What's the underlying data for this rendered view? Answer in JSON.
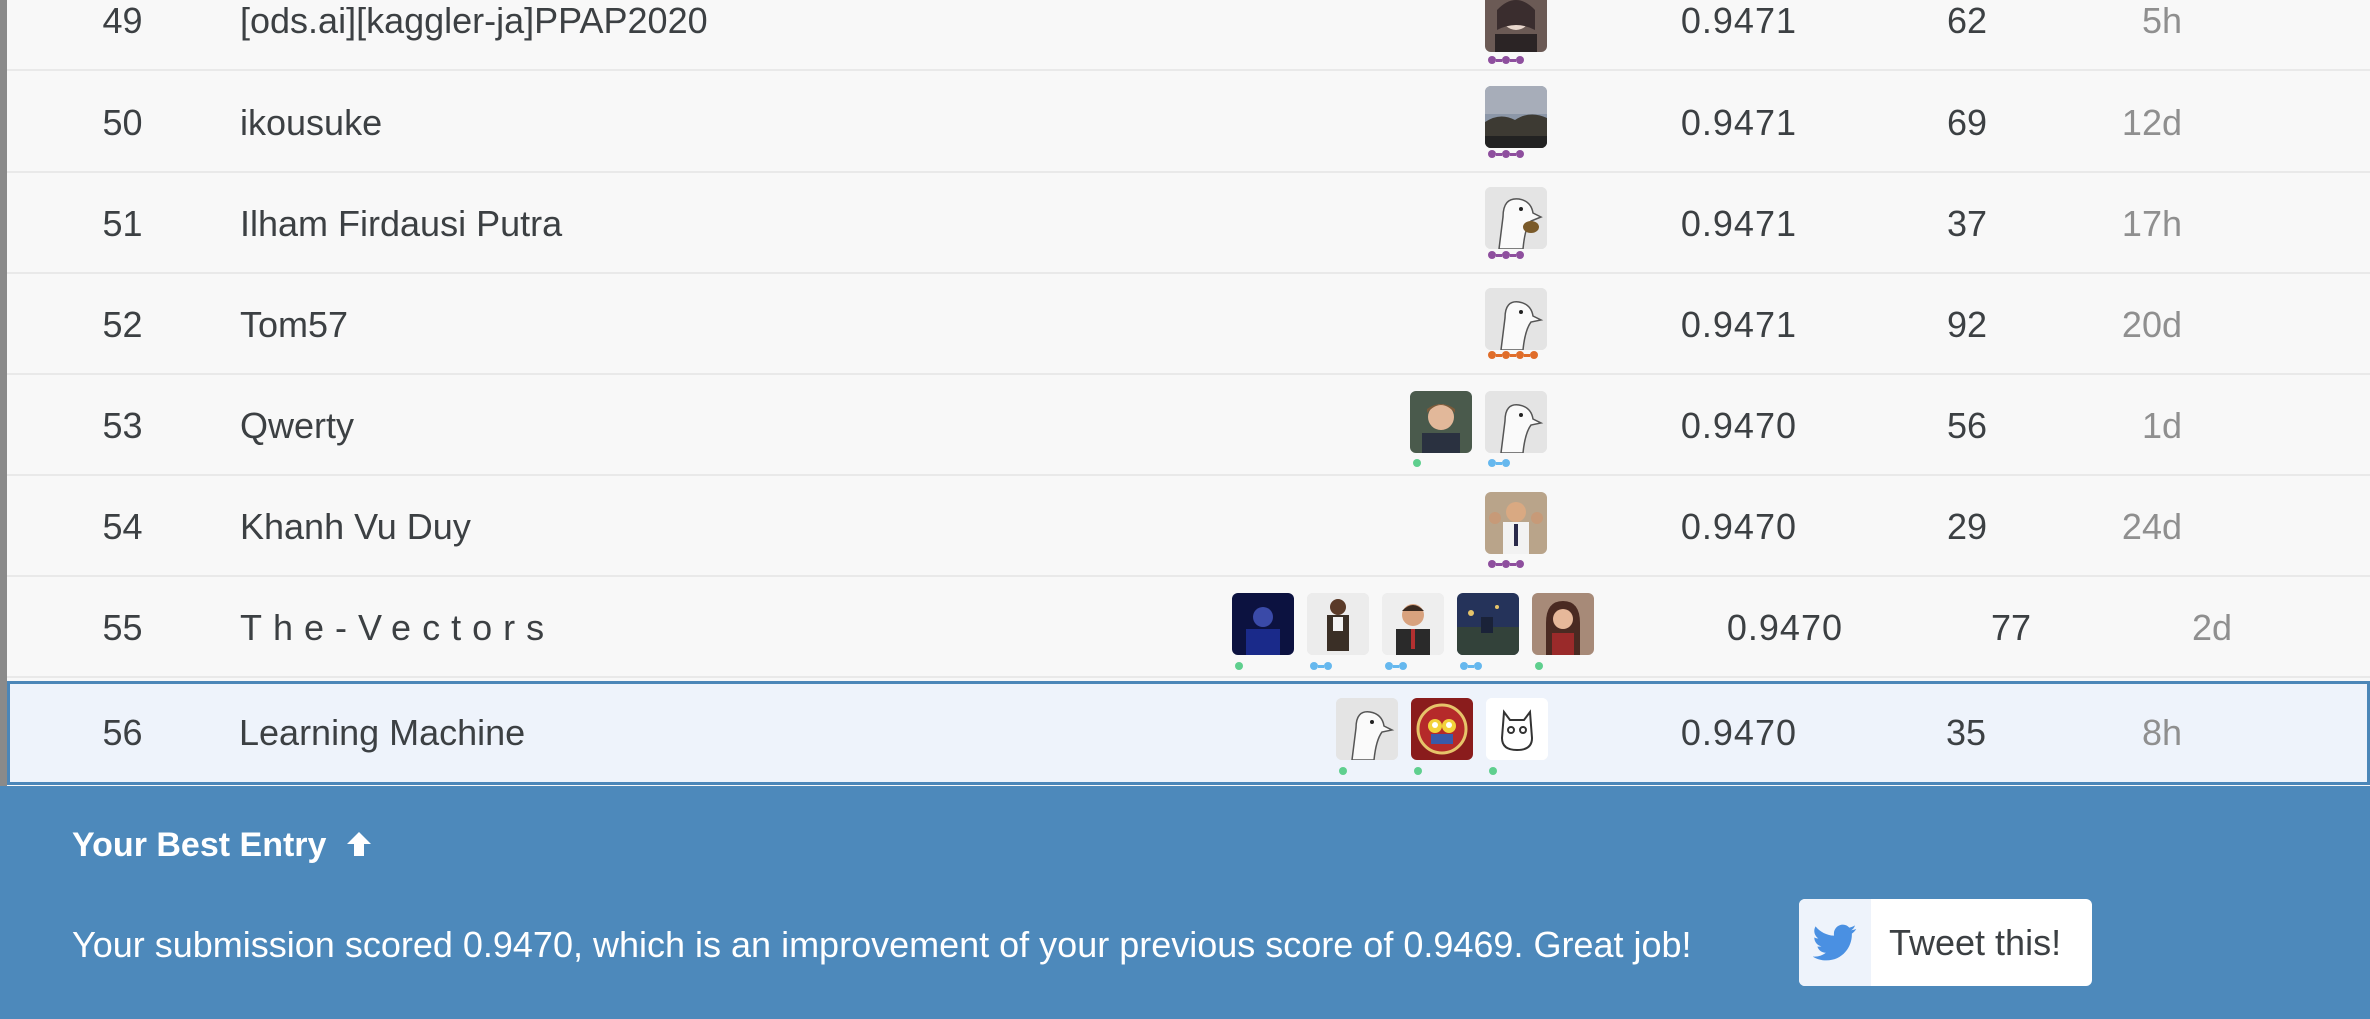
{
  "leaderboard": {
    "rows": [
      {
        "rank": "49",
        "team": "[ods.ai][kaggler-ja]PPAP2020",
        "score": "0.9471",
        "entries": "62",
        "last": "5h"
      },
      {
        "rank": "50",
        "team": "ikousuke",
        "score": "0.9471",
        "entries": "69",
        "last": "12d"
      },
      {
        "rank": "51",
        "team": "Ilham Firdausi Putra",
        "score": "0.9471",
        "entries": "37",
        "last": "17h"
      },
      {
        "rank": "52",
        "team": "Tom57",
        "score": "0.9471",
        "entries": "92",
        "last": "20d"
      },
      {
        "rank": "53",
        "team": "Qwerty",
        "score": "0.9470",
        "entries": "56",
        "last": "1d"
      },
      {
        "rank": "54",
        "team": "Khanh Vu Duy",
        "score": "0.9470",
        "entries": "29",
        "last": "24d"
      },
      {
        "rank": "55",
        "team": "The-Vectors",
        "score": "0.9470",
        "entries": "77",
        "last": "2d"
      },
      {
        "rank": "56",
        "team": "Learning Machine",
        "score": "0.9470",
        "entries": "35",
        "last": "8h"
      }
    ]
  },
  "banner": {
    "title": "Your Best Entry",
    "arrow_icon": "arrow-up-icon",
    "message": "Your submission scored 0.9470, which is an improvement of your previous score of 0.9469. Great job!",
    "tweet_label": "Tweet this!",
    "tweet_icon": "twitter-bird-icon"
  },
  "colors": {
    "banner_bg": "#4d89bb",
    "highlight_border": "#4b86b8",
    "tier_grandmaster": "#8e4f9e",
    "tier_master": "#e06d2a",
    "tier_expert": "#66b8ee",
    "tier_contributor": "#5fcf8e",
    "twitter_blue": "#4a90e2"
  }
}
